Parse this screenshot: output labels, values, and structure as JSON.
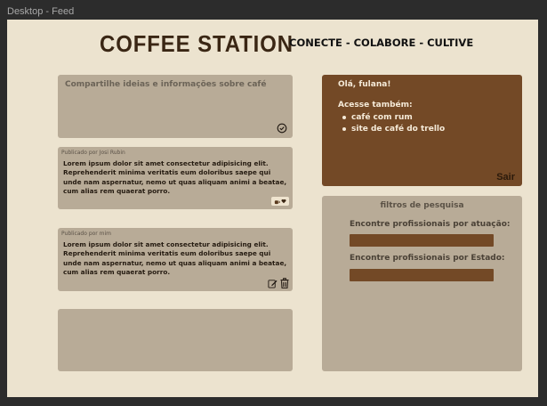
{
  "frame": {
    "label": "Desktop - Feed"
  },
  "header": {
    "brand": "COFFEE STATION",
    "tagline": "CONECTE - COLABORE - CULTIVE"
  },
  "composer": {
    "placeholder": "Compartilhe ideias e informações sobre café",
    "submit_icon": "check-circle-icon"
  },
  "posts": [
    {
      "meta": "Publicado por Josi Rubin",
      "text": "Lorem ipsum dolor sit amet consectetur adipisicing elit. Reprehenderit minima veritatis eum doloribus saepe qui unde nam aspernatur, nemo ut quas aliquam animi a beatae, cum alias rem quaerat porro.",
      "actions": [
        "coffee-cup-icon",
        "heart-icon"
      ]
    },
    {
      "meta": "Publicado por mim",
      "text": "Lorem ipsum dolor sit amet consectetur adipisicing elit. Reprehenderit minima veritatis eum doloribus saepe qui unde nam aspernatur, nemo ut quas aliquam animi a beatae, cum alias rem quaerat porro.",
      "actions": [
        "edit-icon",
        "trash-icon"
      ]
    }
  ],
  "welcome": {
    "greeting": "Olá, fulana!",
    "see_also": "Acesse também:",
    "links": [
      "café com rum",
      "site de café do trello"
    ],
    "logout": "Sair"
  },
  "filters": {
    "title": "filtros de pesquisa",
    "by_role_label": "Encontre profissionais por atuação:",
    "by_state_label": "Encontre profissionais por Estado:"
  },
  "colors": {
    "background": "#ece3cf",
    "card": "#b8ab97",
    "accent": "#734926",
    "brand_text": "#3a2614"
  }
}
